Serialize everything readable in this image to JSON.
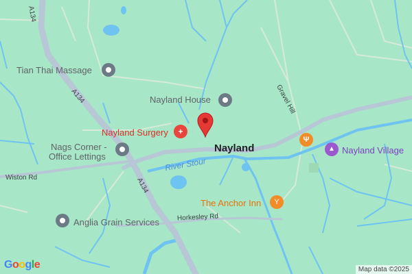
{
  "map": {
    "colors": {
      "land": "#a8e6c8",
      "water": "#6ec3f0",
      "major_road": "#b8c7d6",
      "minor_road": "#d7ead8",
      "marker": "#e53935"
    },
    "places": {
      "town": "Nayland",
      "nayland_village": "Nayland Village",
      "nags_corner_line1": "Nags Corner -",
      "nags_corner_line2": "Office Lettings"
    },
    "pois": {
      "tian_thai": "Tian Thai Massage",
      "nayland_house": "Nayland House",
      "surgery": "Nayland Surgery",
      "anchor_inn": "The Anchor Inn",
      "anglia_grain": "Anglia Grain Services"
    },
    "roads": {
      "a134_top": "A134",
      "a134_mid": "A134",
      "a134_low": "A134",
      "wiston_rd": "Wiston Rd",
      "horkesley_rd": "Horkesley Rd",
      "gravel_hill": "Gravel Hill"
    },
    "water": {
      "river_stour": "River Stour"
    },
    "icons": {
      "pin": "map-marker",
      "grey": "generic-place-pin",
      "surgery": "medical-cross",
      "food": "restaurant",
      "bar": "cocktail",
      "village": "landmark"
    },
    "footer": {
      "logo": "Google",
      "attribution": "Map data ©2025"
    }
  }
}
